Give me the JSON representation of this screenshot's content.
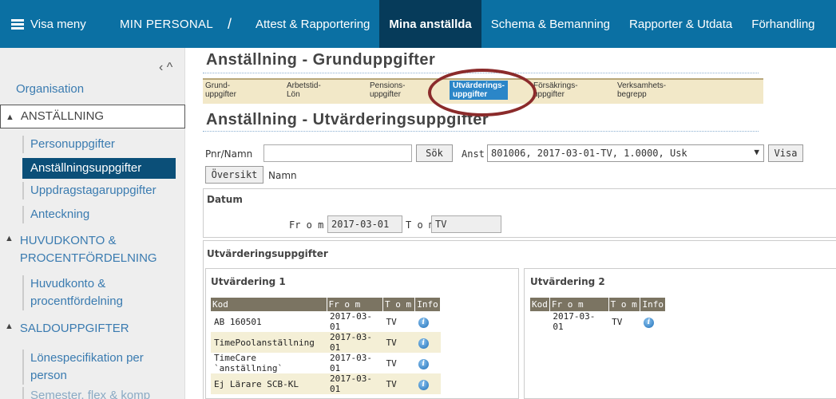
{
  "topnav": {
    "menu_label": "Visa meny",
    "app_title": "MIN PERSONAL",
    "separator": "/",
    "tabs": [
      {
        "label": "Attest & Rapportering"
      },
      {
        "label": "Mina anställda"
      },
      {
        "label": "Schema & Bemanning"
      },
      {
        "label": "Rapporter & Utdata"
      },
      {
        "label": "Förhandling"
      }
    ],
    "active_tab": "Mina anställda",
    "colors": {
      "bar": "#0b70a3",
      "active": "#063b5a"
    }
  },
  "sidebar": {
    "collapse_glyph": "‹ ^",
    "organisation": "Organisation",
    "sections": [
      {
        "label": "ANSTÄLLNING",
        "items": [
          "Personuppgifter",
          "Anställningsuppgifter",
          "Uppdragstagaruppgifter",
          "Anteckning"
        ]
      },
      {
        "label": "HUVUDKONTO & PROCENTFÖRDELNING",
        "items": [
          "Huvudkonto & procentfördelning"
        ]
      },
      {
        "label": "SALDOUPPGIFTER",
        "items": [
          "Lönespecifikation per person",
          "Semester, flex & komp"
        ]
      }
    ],
    "active_item": "Anställningsuppgifter"
  },
  "main": {
    "title1": "Anställning - Grunduppgifter",
    "title2": "Anställning - Utvärderingsuppgifter",
    "subtabs": [
      {
        "line1": "Grund-",
        "line2": "uppgifter"
      },
      {
        "line1": "Arbetstid-",
        "line2": "Lön"
      },
      {
        "line1": "Pensions-",
        "line2": "uppgifter"
      },
      {
        "line1": "Utvärderings-",
        "line2": "uppgifter"
      },
      {
        "line1": "Försäkrings-",
        "line2": "uppgifter"
      },
      {
        "line1": "Verksamhets-",
        "line2": "begrepp"
      }
    ],
    "search": {
      "pnr_label": "Pnr/Namn",
      "pnr_value": "",
      "search_button": "Sök",
      "anst_label": "Anst",
      "anst_value": "801006, 2017-03-01-TV, 1.0000, Usk",
      "show_button": "Visa",
      "overview_button": "Översikt",
      "name_label": "Namn"
    },
    "datum": {
      "heading": "Datum",
      "from_label": "Fr o m",
      "from_value": "2017-03-01",
      "to_label": "T o m",
      "to_value": "TV"
    },
    "utv": {
      "heading": "Utvärderingsuppgifter",
      "panel1": {
        "heading": "Utvärdering 1",
        "columns": [
          "Kod",
          "Fr o m",
          "T o m",
          "Info"
        ],
        "rows": [
          {
            "kod": "AB 160501",
            "from": "2017-03-01",
            "to": "TV"
          },
          {
            "kod": "TimePoolanställning",
            "from": "2017-03-01",
            "to": "TV"
          },
          {
            "kod": "TimeCare `anställning`",
            "from": "2017-03-01",
            "to": "TV"
          },
          {
            "kod": "Ej Lärare SCB-KL",
            "from": "2017-03-01",
            "to": "TV"
          }
        ]
      },
      "panel2": {
        "heading": "Utvärdering 2",
        "columns": [
          "Kod",
          "Fr o m",
          "T o m",
          "Info"
        ],
        "rows": [
          {
            "kod": "",
            "from": "2017-03-01",
            "to": "TV"
          }
        ]
      }
    },
    "icons": {
      "info": "info-icon"
    }
  }
}
